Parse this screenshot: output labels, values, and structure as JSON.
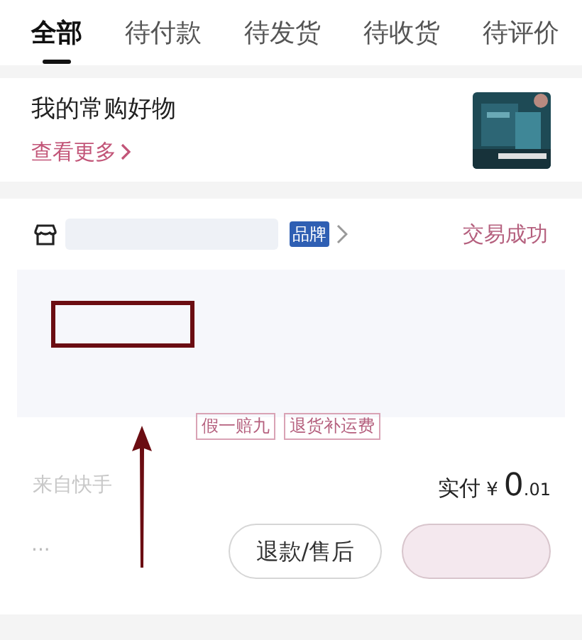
{
  "tabs": [
    {
      "label": "全部",
      "selected": true
    },
    {
      "label": "待付款",
      "selected": false
    },
    {
      "label": "待发货",
      "selected": false
    },
    {
      "label": "待收货",
      "selected": false
    },
    {
      "label": "待评价",
      "selected": false
    }
  ],
  "favorites": {
    "title": "我的常购好物",
    "link": "查看更多"
  },
  "order": {
    "brand_badge": "品牌",
    "status": "交易成功",
    "tags": [
      "假一赔九",
      "退货补运费"
    ],
    "source": "来自快手",
    "paid_label": "实付",
    "currency": "¥",
    "amount_main": "0",
    "amount_cents": ".01",
    "more": "···",
    "buttons": [
      "退款/售后"
    ]
  }
}
